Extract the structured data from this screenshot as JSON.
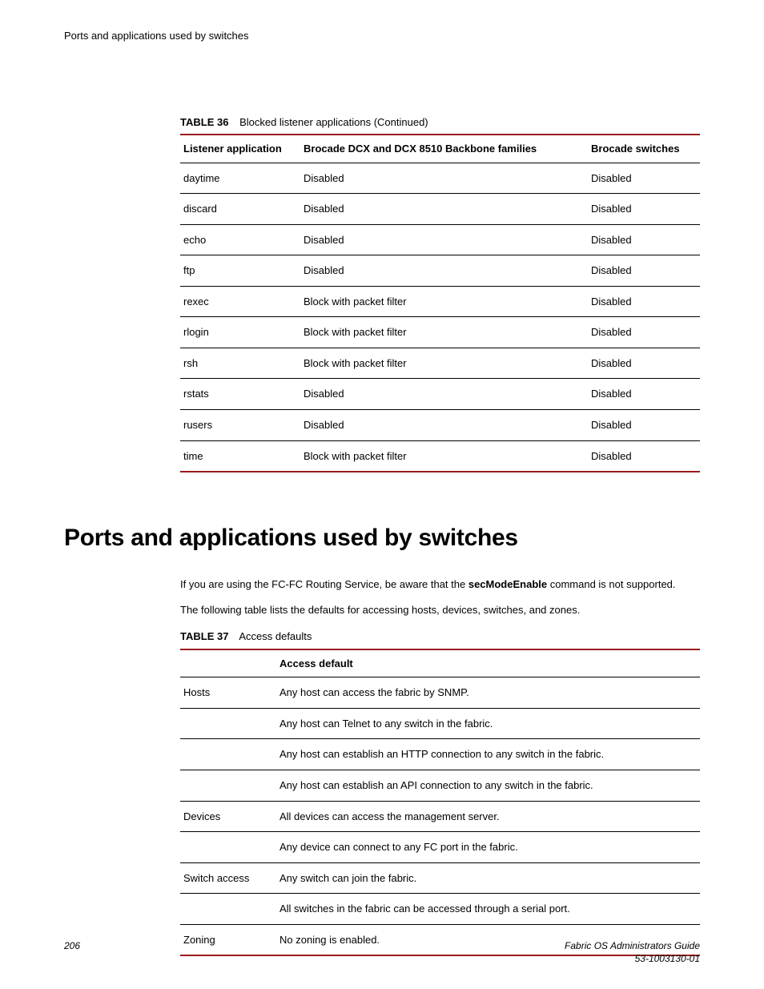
{
  "running_head": "Ports and applications used by switches",
  "table36": {
    "caption_label": "TABLE 36",
    "caption_text": "Blocked listener applications (Continued)",
    "headers": [
      "Listener application",
      "Brocade DCX and DCX 8510 Backbone families",
      "Brocade switches"
    ],
    "rows": [
      [
        "daytime",
        "Disabled",
        "Disabled"
      ],
      [
        "discard",
        "Disabled",
        "Disabled"
      ],
      [
        "echo",
        "Disabled",
        "Disabled"
      ],
      [
        "ftp",
        "Disabled",
        "Disabled"
      ],
      [
        "rexec",
        "Block with packet filter",
        "Disabled"
      ],
      [
        "rlogin",
        "Block with packet filter",
        "Disabled"
      ],
      [
        "rsh",
        "Block with packet filter",
        "Disabled"
      ],
      [
        "rstats",
        "Disabled",
        "Disabled"
      ],
      [
        "rusers",
        "Disabled",
        "Disabled"
      ],
      [
        "time",
        "Block with packet filter",
        "Disabled"
      ]
    ]
  },
  "section_heading": "Ports and applications used by switches",
  "paragraphs": {
    "p1_pre": "If you are using the FC-FC Routing Service, be aware that the ",
    "p1_cmd": "secModeEnable",
    "p1_post": " command is not supported.",
    "p2": "The following table lists the defaults for accessing hosts, devices, switches, and zones."
  },
  "table37": {
    "caption_label": "TABLE 37",
    "caption_text": "Access defaults",
    "headers": [
      "",
      "Access default"
    ],
    "rows": [
      [
        "Hosts",
        "Any host can access the fabric by SNMP."
      ],
      [
        "",
        "Any host can Telnet to any switch in the fabric."
      ],
      [
        "",
        "Any host can establish an HTTP connection to any switch in the fabric."
      ],
      [
        "",
        "Any host can establish an API connection to any switch in the fabric."
      ],
      [
        "Devices",
        "All devices can access the management server."
      ],
      [
        "",
        "Any device can connect to any FC port in the fabric."
      ],
      [
        "Switch access",
        "Any switch can join the fabric."
      ],
      [
        "",
        "All switches in the fabric can be accessed through a serial port."
      ],
      [
        "Zoning",
        "No zoning is enabled."
      ]
    ]
  },
  "footer": {
    "page_number": "206",
    "doc_title": "Fabric OS Administrators Guide",
    "doc_id": "53-1003130-01"
  }
}
